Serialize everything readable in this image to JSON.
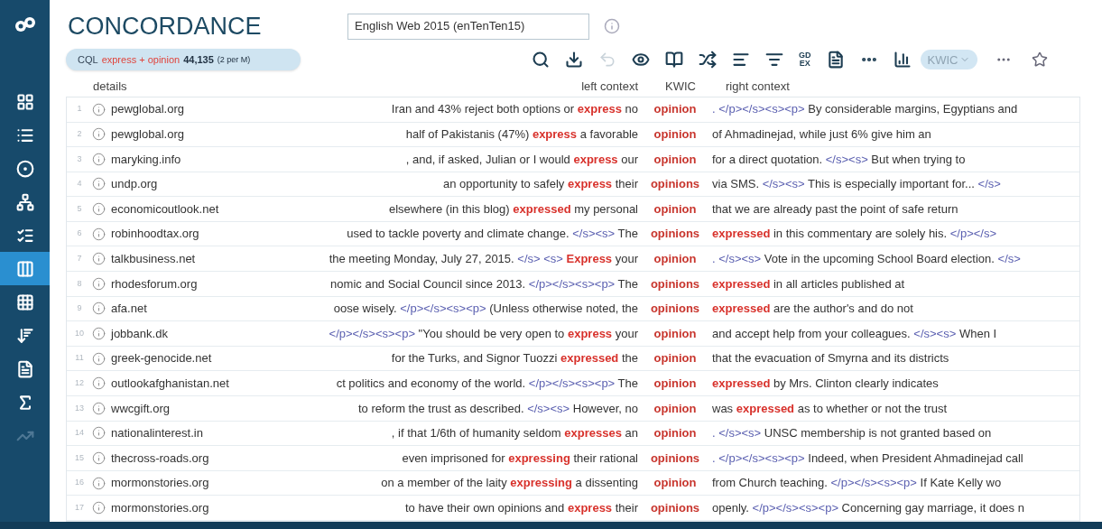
{
  "header": {
    "title": "CONCORDANCE",
    "corpus": "English Web 2015 (enTenTen15)"
  },
  "query": {
    "type": "CQL",
    "terms": "express + opinion",
    "count": "44,135",
    "rate": "(2 per M)"
  },
  "toolbar": {
    "gdex": [
      "GD",
      "EX"
    ],
    "view": "KWIC",
    "undo_disabled": true
  },
  "sidebar": {
    "items": [
      {
        "selected": false
      },
      {
        "selected": false
      },
      {
        "selected": false
      },
      {
        "selected": false
      },
      {
        "selected": false
      },
      {
        "selected": true
      },
      {
        "selected": false
      },
      {
        "selected": false
      },
      {
        "selected": false
      },
      {
        "selected": false
      },
      {
        "selected": false
      }
    ]
  },
  "columns": {
    "details": "details",
    "left": "left context",
    "kwic": "KWIC",
    "right": "right context"
  },
  "rows": [
    {
      "num": "1",
      "source": "pewglobal.org",
      "left": [
        {
          "kind": "text",
          "text": "Iran and 43% reject both options or "
        },
        {
          "kind": "hit",
          "text": "express"
        },
        {
          "kind": "text",
          "text": " no"
        }
      ],
      "kwic": "opinion",
      "right": [
        {
          "kind": "tag",
          "text": ". </p></s><s><p>"
        },
        {
          "kind": "text",
          "text": " By considerable margins, Egyptians and"
        }
      ]
    },
    {
      "num": "2",
      "source": "pewglobal.org",
      "left": [
        {
          "kind": "text",
          "text": "half of Pakistanis (47%) "
        },
        {
          "kind": "hit",
          "text": "express"
        },
        {
          "kind": "text",
          "text": " a favorable"
        }
      ],
      "kwic": "opinion",
      "right": [
        {
          "kind": "text",
          "text": "of Ahmadinejad, while just 6% give him an"
        }
      ]
    },
    {
      "num": "3",
      "source": "maryking.info",
      "left": [
        {
          "kind": "text",
          "text": ", and, if asked, Julian or I would "
        },
        {
          "kind": "hit",
          "text": "express"
        },
        {
          "kind": "text",
          "text": " our"
        }
      ],
      "kwic": "opinion",
      "right": [
        {
          "kind": "text",
          "text": "for a direct quotation. "
        },
        {
          "kind": "tag",
          "text": "</s><s>"
        },
        {
          "kind": "text",
          "text": " But when trying to"
        }
      ]
    },
    {
      "num": "4",
      "source": "undp.org",
      "left": [
        {
          "kind": "text",
          "text": "an opportunity to safely "
        },
        {
          "kind": "hit",
          "text": "express"
        },
        {
          "kind": "text",
          "text": " their"
        }
      ],
      "kwic": "opinions",
      "right": [
        {
          "kind": "text",
          "text": "via SMS. "
        },
        {
          "kind": "tag",
          "text": "</s><s>"
        },
        {
          "kind": "text",
          "text": " This is especially important for... "
        },
        {
          "kind": "tag",
          "text": "</s>"
        }
      ]
    },
    {
      "num": "5",
      "source": "economicoutlook.net",
      "left": [
        {
          "kind": "text",
          "text": "elsewhere (in this blog) "
        },
        {
          "kind": "hit",
          "text": "expressed"
        },
        {
          "kind": "text",
          "text": " my personal"
        }
      ],
      "kwic": "opinion",
      "right": [
        {
          "kind": "text",
          "text": "that we are already past the point of safe return"
        }
      ]
    },
    {
      "num": "6",
      "source": "robinhoodtax.org",
      "left": [
        {
          "kind": "text",
          "text": "used to tackle poverty and climate change. "
        },
        {
          "kind": "tag",
          "text": "</s><s>"
        },
        {
          "kind": "text",
          "text": " The"
        }
      ],
      "kwic": "opinions",
      "right": [
        {
          "kind": "hit",
          "text": "expressed"
        },
        {
          "kind": "text",
          "text": " in this commentary are solely his. "
        },
        {
          "kind": "tag",
          "text": "</p></s>"
        }
      ]
    },
    {
      "num": "7",
      "source": "talkbusiness.net",
      "left": [
        {
          "kind": "text",
          "text": "the meeting Monday, July 27, 2015. "
        },
        {
          "kind": "tag",
          "text": "</s> <s> "
        },
        {
          "kind": "hit",
          "text": "Express"
        },
        {
          "kind": "text",
          "text": " your"
        }
      ],
      "kwic": "opinion",
      "right": [
        {
          "kind": "tag",
          "text": ". </s><s>"
        },
        {
          "kind": "text",
          "text": " Vote in the upcoming School Board election. "
        },
        {
          "kind": "tag",
          "text": "</s>"
        }
      ]
    },
    {
      "num": "8",
      "source": "rhodesforum.org",
      "left": [
        {
          "kind": "text",
          "text": "nomic and Social Council since 2013. "
        },
        {
          "kind": "tag",
          "text": "</p></s><s><p>"
        },
        {
          "kind": "text",
          "text": " The"
        }
      ],
      "kwic": "opinions",
      "right": [
        {
          "kind": "hit",
          "text": "expressed"
        },
        {
          "kind": "text",
          "text": " in all articles published at"
        }
      ]
    },
    {
      "num": "9",
      "source": "afa.net",
      "left": [
        {
          "kind": "text",
          "text": "oose wisely. "
        },
        {
          "kind": "tag",
          "text": "</p></s><s><p>"
        },
        {
          "kind": "text",
          "text": " (Unless otherwise noted, the"
        }
      ],
      "kwic": "opinions",
      "right": [
        {
          "kind": "hit",
          "text": "expressed"
        },
        {
          "kind": "text",
          "text": " are the author's and do not"
        }
      ]
    },
    {
      "num": "10",
      "source": "jobbank.dk",
      "left": [
        {
          "kind": "tag",
          "text": "</p></s><s><p>"
        },
        {
          "kind": "text",
          "text": " \"You should be very open to "
        },
        {
          "kind": "hit",
          "text": "express"
        },
        {
          "kind": "text",
          "text": " your"
        }
      ],
      "kwic": "opinion",
      "right": [
        {
          "kind": "text",
          "text": "and accept help from your colleagues. "
        },
        {
          "kind": "tag",
          "text": "</s><s>"
        },
        {
          "kind": "text",
          "text": " When I"
        }
      ]
    },
    {
      "num": "11",
      "source": "greek-genocide.net",
      "left": [
        {
          "kind": "text",
          "text": "for the Turks, and Signor Tuozzi "
        },
        {
          "kind": "hit",
          "text": "expressed"
        },
        {
          "kind": "text",
          "text": " the"
        }
      ],
      "kwic": "opinion",
      "right": [
        {
          "kind": "text",
          "text": "that the evacuation of Smyrna and its districts"
        }
      ]
    },
    {
      "num": "12",
      "source": "outlookafghanistan.net",
      "left": [
        {
          "kind": "text",
          "text": "ct politics and economy of the world. "
        },
        {
          "kind": "tag",
          "text": "</p></s><s><p>"
        },
        {
          "kind": "text",
          "text": " The"
        }
      ],
      "kwic": "opinion",
      "right": [
        {
          "kind": "hit",
          "text": "expressed"
        },
        {
          "kind": "text",
          "text": " by Mrs. Clinton clearly indicates"
        }
      ]
    },
    {
      "num": "13",
      "source": "wwcgift.org",
      "left": [
        {
          "kind": "text",
          "text": "to reform the trust as described. "
        },
        {
          "kind": "tag",
          "text": "</s><s>"
        },
        {
          "kind": "text",
          "text": " However, no"
        }
      ],
      "kwic": "opinion",
      "right": [
        {
          "kind": "text",
          "text": "was "
        },
        {
          "kind": "hit",
          "text": "expressed"
        },
        {
          "kind": "text",
          "text": " as to whether or not the trust"
        }
      ]
    },
    {
      "num": "14",
      "source": "nationalinterest.in",
      "left": [
        {
          "kind": "text",
          "text": ", if that 1/6th of humanity seldom "
        },
        {
          "kind": "hit",
          "text": "expresses"
        },
        {
          "kind": "text",
          "text": " an"
        }
      ],
      "kwic": "opinion",
      "right": [
        {
          "kind": "tag",
          "text": ". </s><s>"
        },
        {
          "kind": "text",
          "text": " UNSC membership is not granted based on"
        }
      ]
    },
    {
      "num": "15",
      "source": "thecross-roads.org",
      "left": [
        {
          "kind": "text",
          "text": "even imprisoned for "
        },
        {
          "kind": "hit",
          "text": "expressing"
        },
        {
          "kind": "text",
          "text": " their rational"
        }
      ],
      "kwic": "opinions",
      "right": [
        {
          "kind": "tag",
          "text": ". </p></s><s><p>"
        },
        {
          "kind": "text",
          "text": " Indeed, when President Ahmadinejad call"
        }
      ]
    },
    {
      "num": "16",
      "source": "mormonstories.org",
      "left": [
        {
          "kind": "text",
          "text": "on a member of the laity "
        },
        {
          "kind": "hit",
          "text": "expressing"
        },
        {
          "kind": "text",
          "text": " a dissenting"
        }
      ],
      "kwic": "opinion",
      "right": [
        {
          "kind": "text",
          "text": "from Church teaching. "
        },
        {
          "kind": "tag",
          "text": "</p></s><s><p>"
        },
        {
          "kind": "text",
          "text": " If Kate Kelly wo"
        }
      ]
    },
    {
      "num": "17",
      "source": "mormonstories.org",
      "left": [
        {
          "kind": "text",
          "text": "to have their own opinions and "
        },
        {
          "kind": "hit",
          "text": "express"
        },
        {
          "kind": "text",
          "text": " their"
        }
      ],
      "kwic": "opinions",
      "right": [
        {
          "kind": "text",
          "text": "openly. "
        },
        {
          "kind": "tag",
          "text": "</p></s><s><p>"
        },
        {
          "kind": "text",
          "text": " Concerning gay marriage, it does n"
        }
      ]
    }
  ]
}
